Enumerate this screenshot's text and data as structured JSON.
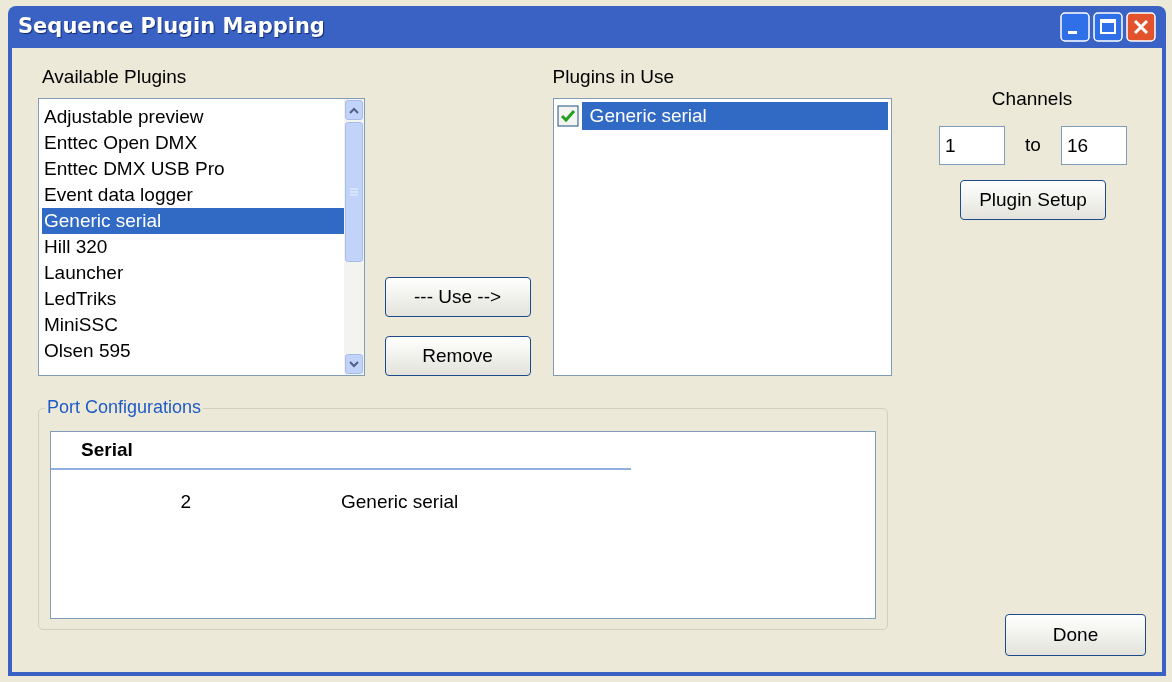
{
  "window": {
    "title": "Sequence Plugin Mapping"
  },
  "available_plugins": {
    "label": "Available Plugins",
    "items": [
      {
        "label": "Adjustable preview",
        "selected": false
      },
      {
        "label": "Enttec Open DMX",
        "selected": false
      },
      {
        "label": "Enttec DMX USB Pro",
        "selected": false
      },
      {
        "label": "Event data logger",
        "selected": false
      },
      {
        "label": "Generic serial",
        "selected": true
      },
      {
        "label": "Hill 320",
        "selected": false
      },
      {
        "label": "Launcher",
        "selected": false
      },
      {
        "label": "LedTriks",
        "selected": false
      },
      {
        "label": "MiniSSC",
        "selected": false
      },
      {
        "label": "Olsen 595",
        "selected": false
      }
    ]
  },
  "use_button": "--- Use -->",
  "remove_button": "Remove",
  "plugins_in_use": {
    "label": "Plugins in Use",
    "items": [
      {
        "label": "Generic serial",
        "checked": true,
        "selected": true
      }
    ]
  },
  "channels": {
    "label": "Channels",
    "from": "1",
    "to_label": "to",
    "to": "16"
  },
  "plugin_setup_button": "Plugin Setup",
  "port_configurations": {
    "title": "Port Configurations",
    "columns": [
      "Serial"
    ],
    "rows": [
      [
        "2",
        "Generic serial"
      ]
    ]
  },
  "done_button": "Done"
}
